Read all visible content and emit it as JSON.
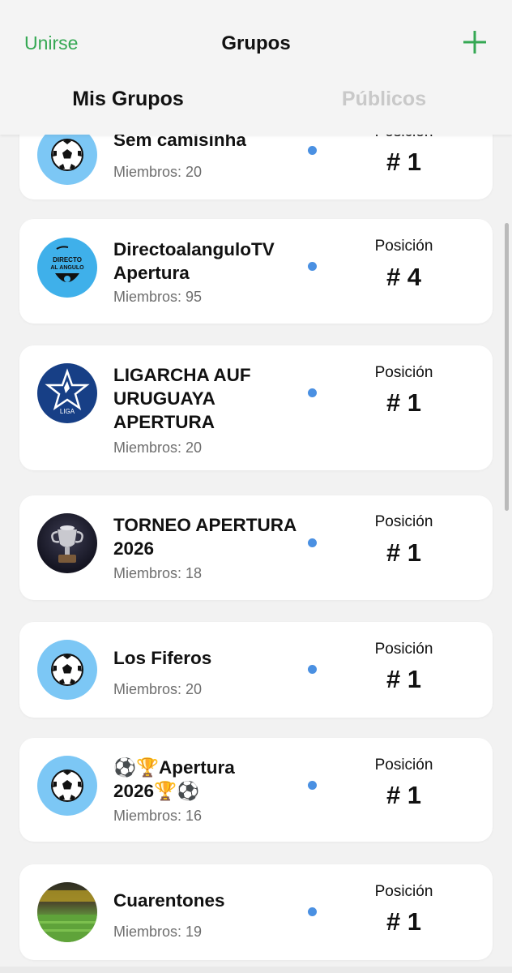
{
  "header": {
    "join_label": "Unirse",
    "title": "Grupos",
    "add_icon": "plus-icon",
    "accent": "#35a853"
  },
  "tabs": [
    {
      "label": "Mis Grupos",
      "active": true
    },
    {
      "label": "Públicos",
      "active": false
    }
  ],
  "groups": [
    {
      "name": "Sem camisinha",
      "members": "Miembros: 20",
      "position_label": "Posición",
      "position": "# 1",
      "avatar": "soccer-ball"
    },
    {
      "name": "DirectoalanguloTV Apertura",
      "members": "Miembros: 95",
      "position_label": "Posición",
      "position": "# 4",
      "avatar": "directo-al-angulo-logo"
    },
    {
      "name": "LIGARCHA AUF URUGUAYA APERTURA",
      "members": "Miembros: 20",
      "position_label": "Posición",
      "position": "# 1",
      "avatar": "liga-auf-logo"
    },
    {
      "name": "TORNEO APERTURA 2026",
      "members": "Miembros: 18",
      "position_label": "Posición",
      "position": "# 1",
      "avatar": "trophy-photo"
    },
    {
      "name": "Los Fiferos",
      "members": "Miembros: 20",
      "position_label": "Posición",
      "position": "# 1",
      "avatar": "soccer-ball"
    },
    {
      "name": "⚽🏆Apertura 2026🏆⚽",
      "members": "Miembros: 16",
      "position_label": "Posición",
      "position": "# 1",
      "avatar": "soccer-ball"
    },
    {
      "name": "Cuarentones",
      "members": "Miembros: 19",
      "position_label": "Posición",
      "position": "# 1",
      "avatar": "stadium-photo"
    }
  ],
  "colors": {
    "unread_dot": "#4a90e2",
    "ball_avatar_bg": "#7cc7f5"
  }
}
